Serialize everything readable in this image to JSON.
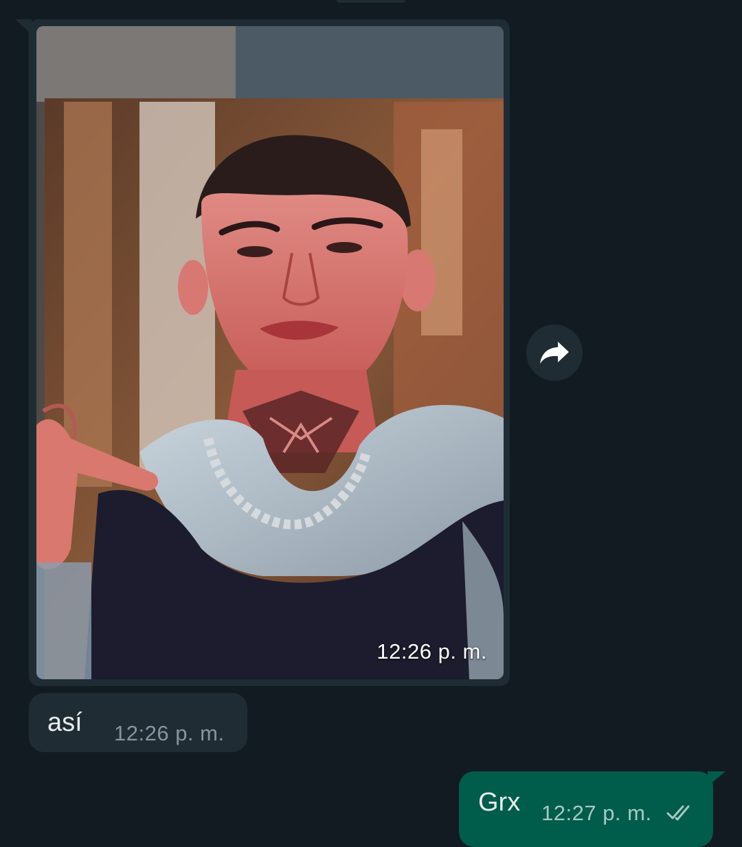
{
  "messages": [
    {
      "direction": "incoming",
      "type": "image",
      "time": "12:26 p. m."
    },
    {
      "direction": "incoming",
      "type": "text",
      "text": "así",
      "time": "12:26 p. m."
    },
    {
      "direction": "outgoing",
      "type": "text",
      "text": "Grx",
      "time": "12:27 p. m.",
      "status_icon": "double-check-icon"
    }
  ],
  "icons": {
    "forward": "forward-arrow-icon"
  },
  "colors": {
    "background": "#121b22",
    "incoming_bubble": "#1f2c34",
    "outgoing_bubble": "#005c4b",
    "text": "#e9edef",
    "meta_text": "#8696a0"
  }
}
